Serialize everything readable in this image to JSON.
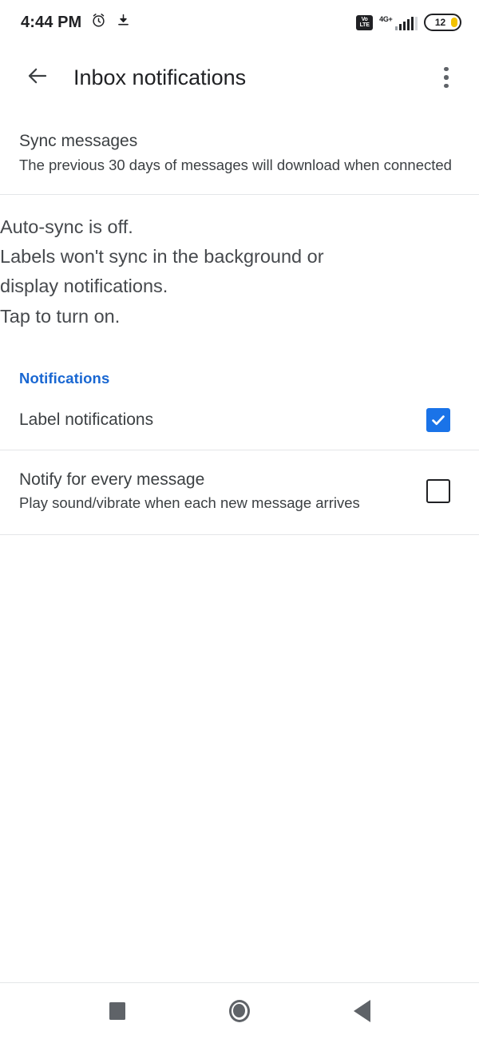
{
  "status_bar": {
    "time": "4:44 PM",
    "alarm_icon": "alarm-clock-icon",
    "download_icon": "download-icon",
    "volte_top": "Vo",
    "volte_bottom": "LTE",
    "network_type": "4G+",
    "battery_percent": "12",
    "battery_color": "#f2c200"
  },
  "app_bar": {
    "back_icon": "back-arrow-icon",
    "title": "Inbox notifications",
    "overflow_icon": "more-options-icon"
  },
  "sync_row": {
    "title": "Sync messages",
    "subtitle": "The previous 30 days of messages will download when connected"
  },
  "auto_sync": {
    "line1": "Auto-sync is off.",
    "line2": "Labels won't sync in the background or",
    "line3": "display notifications.",
    "line4": "Tap to turn on."
  },
  "notifications_section": {
    "header": "Notifications",
    "header_color": "#1967d2",
    "items": [
      {
        "title": "Label notifications",
        "subtitle": "",
        "checked": true
      },
      {
        "title": "Notify for every message",
        "subtitle": "Play sound/vibrate when each new message arrives",
        "checked": false
      }
    ],
    "checked_color": "#1a73e8"
  },
  "nav_bar": {
    "recents_label": "recents",
    "home_label": "home",
    "back_label": "back"
  }
}
